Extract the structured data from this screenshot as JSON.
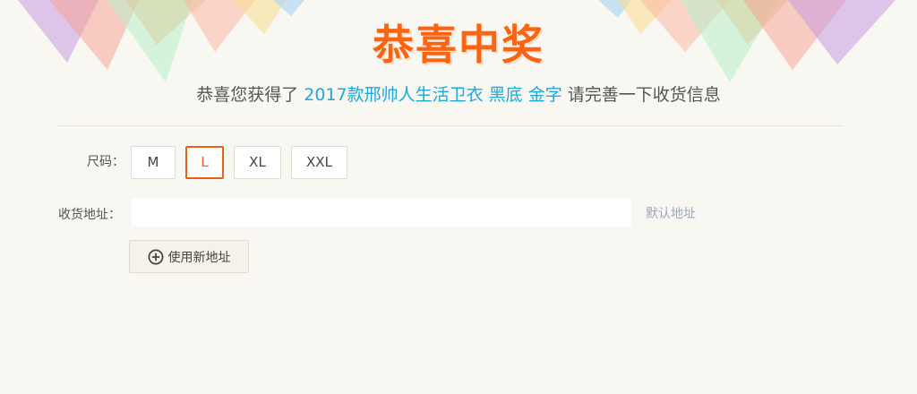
{
  "title": "恭喜中奖",
  "subtitle": {
    "prefix": "恭喜您获得了 ",
    "prize": "2017款邢帅人生活卫衣 黑底 金字",
    "suffix": " 请完善一下收货信息"
  },
  "colors": {
    "accent_orange": "#fa6412",
    "prize_blue": "#1ea9dc",
    "background": "#f8f7f2",
    "link_gray": "#9aa6bd"
  },
  "size": {
    "label": "尺码：",
    "options": [
      "M",
      "L",
      "XL",
      "XXL"
    ],
    "selected": "L"
  },
  "address": {
    "label": "收货地址：",
    "value": "",
    "default_link": "默认地址"
  },
  "new_address_button": {
    "icon": "plus-circle-icon",
    "label": "使用新地址"
  }
}
